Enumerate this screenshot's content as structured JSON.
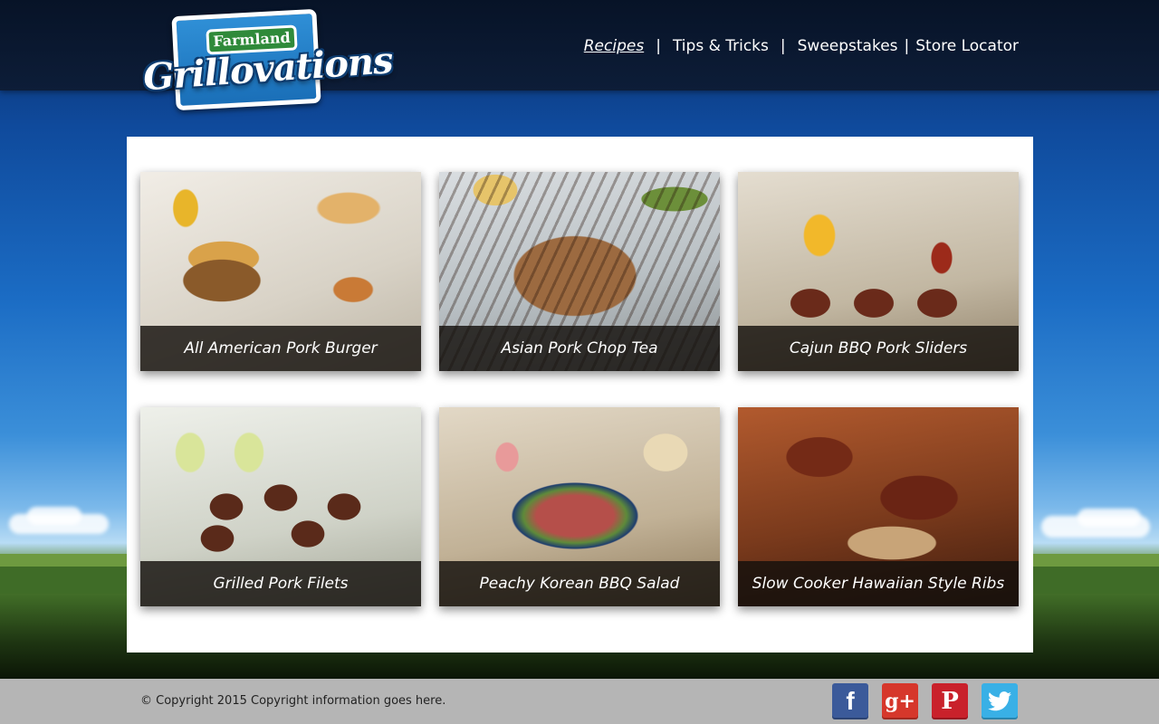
{
  "brand": {
    "logo_top": "Farmland",
    "logo_script": "Grillovations"
  },
  "nav": {
    "items": [
      {
        "label": "Recipes",
        "active": true
      },
      {
        "label": "Tips & Tricks"
      },
      {
        "label": "Sweepstakes"
      },
      {
        "label": "Store Locator"
      }
    ],
    "separator": "|"
  },
  "recipes": [
    {
      "title": "All American Pork Burger"
    },
    {
      "title": "Asian Pork Chop Tea"
    },
    {
      "title": "Cajun BBQ Pork Sliders"
    },
    {
      "title": "Grilled Pork Filets"
    },
    {
      "title": "Peachy Korean BBQ Salad"
    },
    {
      "title": "Slow Cooker Hawaiian Style Ribs"
    }
  ],
  "footer": {
    "copyright": "© Copyright 2015 Copyright information goes here.",
    "socials": [
      {
        "name": "facebook-icon",
        "glyph": "f"
      },
      {
        "name": "google-plus-icon",
        "glyph": "g+"
      },
      {
        "name": "pinterest-icon",
        "glyph": "P"
      },
      {
        "name": "twitter-icon",
        "glyph": ""
      }
    ]
  },
  "colors": {
    "header_bg": "#0a1730",
    "footer_bg": "#b5b5b5",
    "caption_bg": "#14100c",
    "facebook": "#3b5a9a",
    "google_plus": "#d6372b",
    "pinterest": "#c9212b",
    "twitter": "#39b0e6"
  }
}
